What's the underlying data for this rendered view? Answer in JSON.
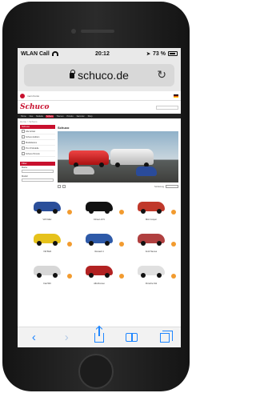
{
  "status": {
    "carrier": "WLAN Call",
    "time": "20:12",
    "battery": "73 %"
  },
  "browser": {
    "url": "schuco.de"
  },
  "site": {
    "logo": "Schuco",
    "account": "mein Konto",
    "nav": [
      "Home",
      "Neu",
      "Modelle",
      "Schuco",
      "Themen",
      "Piccolo",
      "Sammler",
      "Shop"
    ],
    "active_nav": "Schuco",
    "breadcrumb": "Home > Schuco",
    "page_title": "Schuco",
    "sidebar_heading": "Schuco",
    "sidebar_items": [
      "Alle Artikel",
      "Schuco Edition",
      "Modellautos",
      "Pro.R Modelle",
      "Schuco Piccolo"
    ],
    "filter_heading": "Filter",
    "filter_labels": [
      "Marke",
      "Modell"
    ],
    "toolbar_sort": "Sortierung"
  },
  "products": [
    {
      "name": "VW Käfer",
      "color": "#2b4f9a"
    },
    {
      "name": "Citroen 2CV",
      "color": "#111111"
    },
    {
      "name": "Mini Cooper",
      "color": "#c0392b"
    },
    {
      "name": "VW Bulli",
      "color": "#e6c21c"
    },
    {
      "name": "Renault 4",
      "color": "#2e5aa8"
    },
    {
      "name": "Ford Taunus",
      "color": "#b04040"
    },
    {
      "name": "Fiat 500",
      "color": "#d7d7d7"
    },
    {
      "name": "Alfa Romeo",
      "color": "#b22222"
    },
    {
      "name": "Porsche 911",
      "color": "#e0e0e0"
    }
  ]
}
